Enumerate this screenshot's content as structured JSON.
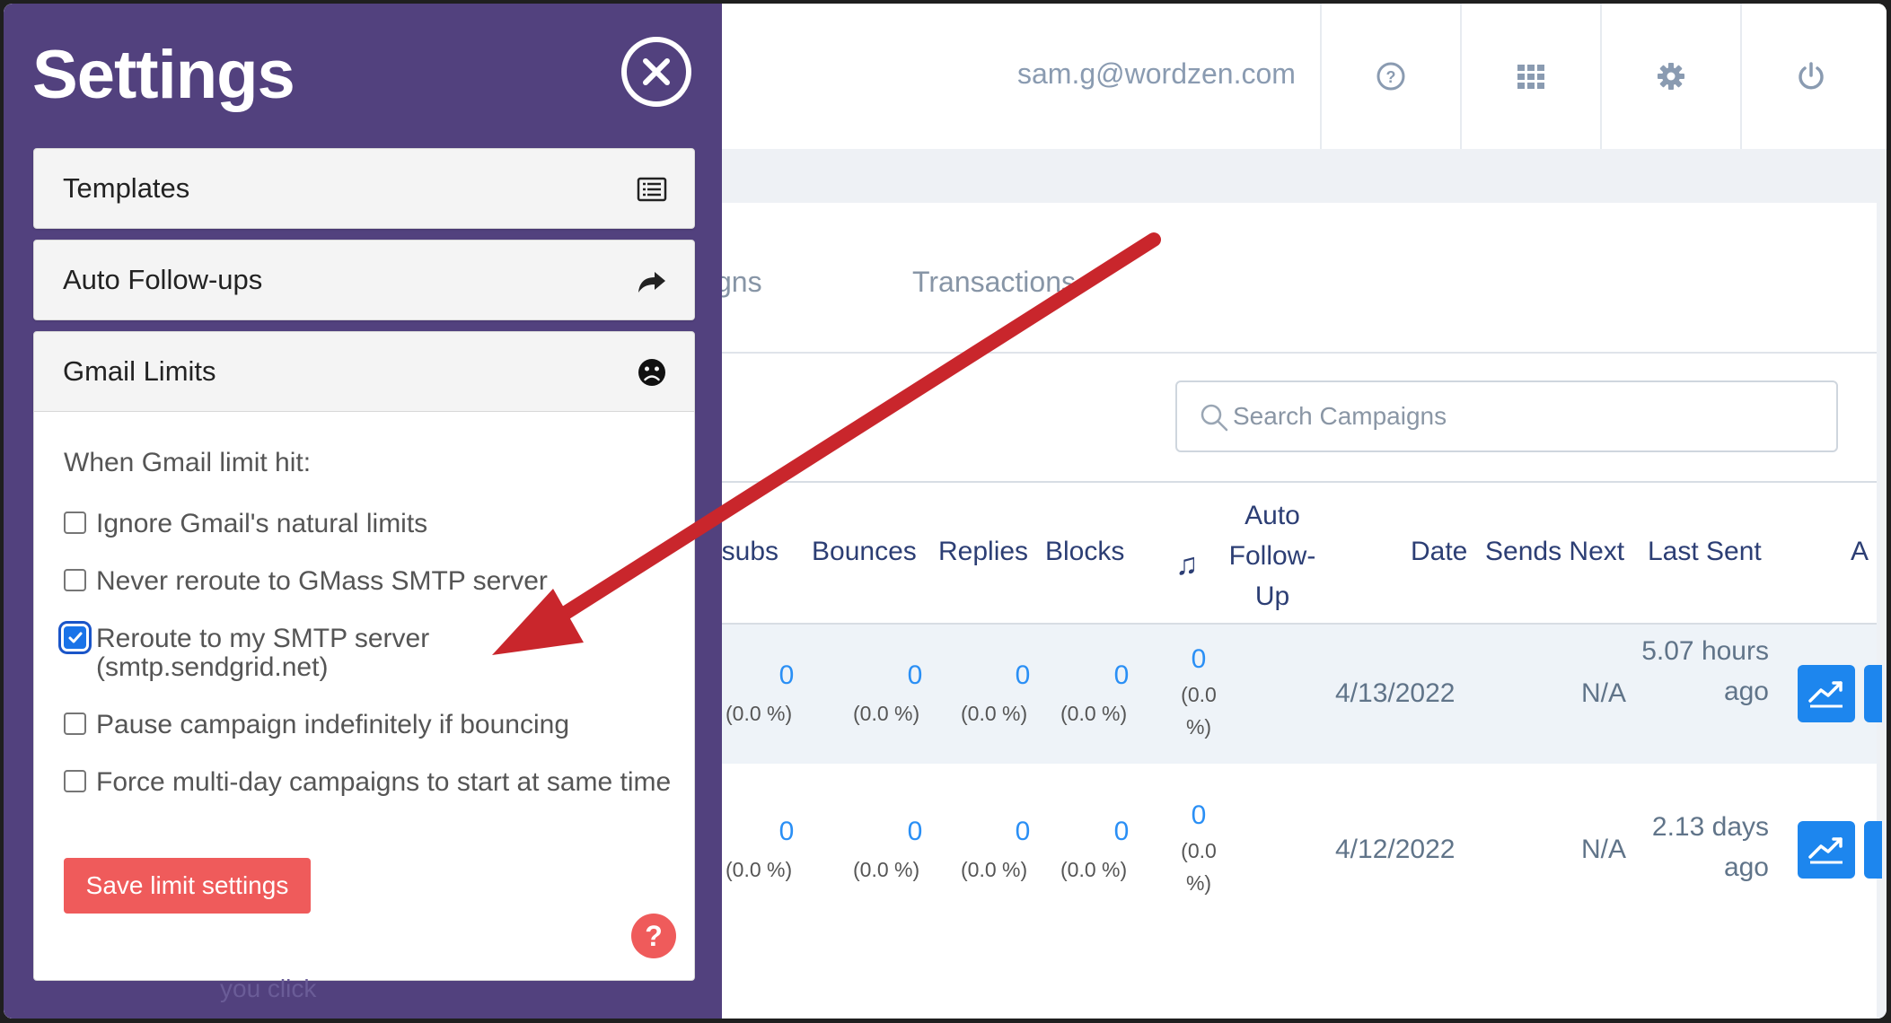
{
  "topbar": {
    "user_email": "sam.g@wordzen.com",
    "icons": [
      "help-icon",
      "apps-grid-icon",
      "gear-icon",
      "power-icon"
    ]
  },
  "tabs": [
    "gns",
    "Transactions"
  ],
  "search": {
    "placeholder": "Search Campaigns"
  },
  "table": {
    "headers": {
      "unsubs": "nsubs",
      "bounces": "Bounces",
      "replies": "Replies",
      "blocks": "Blocks",
      "auto_followup": "Auto Follow-Up",
      "date": "Date",
      "sends_next": "Sends Next",
      "last_sent": "Last Sent",
      "actions": "A"
    },
    "rows": [
      {
        "unsubs": "0",
        "unsubs_pct": "(0.0 %)",
        "bounces": "0",
        "bounces_pct": "(0.0 %)",
        "replies": "0",
        "replies_pct": "(0.0 %)",
        "blocks": "0",
        "blocks_pct": "(0.0 %)",
        "auto_followup": "0",
        "auto_followup_pct": "(0.0 %)",
        "date": "4/13/2022",
        "sends_next": "N/A",
        "last_sent": "5.07 hours ago"
      },
      {
        "unsubs": "0",
        "unsubs_pct": "(0.0 %)",
        "bounces": "0",
        "bounces_pct": "(0.0 %)",
        "replies": "0",
        "replies_pct": "(0.0 %)",
        "blocks": "0",
        "blocks_pct": "(0.0 %)",
        "auto_followup": "0",
        "auto_followup_pct": "(0.0 %)",
        "date": "4/12/2022",
        "sends_next": "N/A",
        "last_sent": "2.13 days ago"
      }
    ]
  },
  "sidebar": {
    "title": "Settings",
    "items": [
      {
        "label": "Templates",
        "icon": "list-icon"
      },
      {
        "label": "Auto Follow-ups",
        "icon": "share-arrow-icon"
      },
      {
        "label": "Gmail Limits",
        "icon": "frown-icon"
      }
    ],
    "gmail_limits": {
      "heading": "When Gmail limit hit:",
      "options": [
        {
          "label": "Ignore Gmail's natural limits",
          "checked": false
        },
        {
          "label": "Never reroute to GMass SMTP server",
          "checked": false
        },
        {
          "label": "Reroute to my SMTP server",
          "sublabel": "(smtp.sendgrid.net)",
          "checked": true
        },
        {
          "label": "Pause campaign indefinitely if bouncing",
          "checked": false
        },
        {
          "label": "Force multi-day campaigns to start at same time",
          "checked": false
        }
      ],
      "save_label": "Save limit settings",
      "help_label": "?"
    },
    "faint_text": "you click"
  },
  "colors": {
    "sidebar_bg": "#52417e",
    "accent_blue": "#2a8ff5",
    "save_red": "#ef5b5b",
    "arrow_red": "#c9262c"
  }
}
